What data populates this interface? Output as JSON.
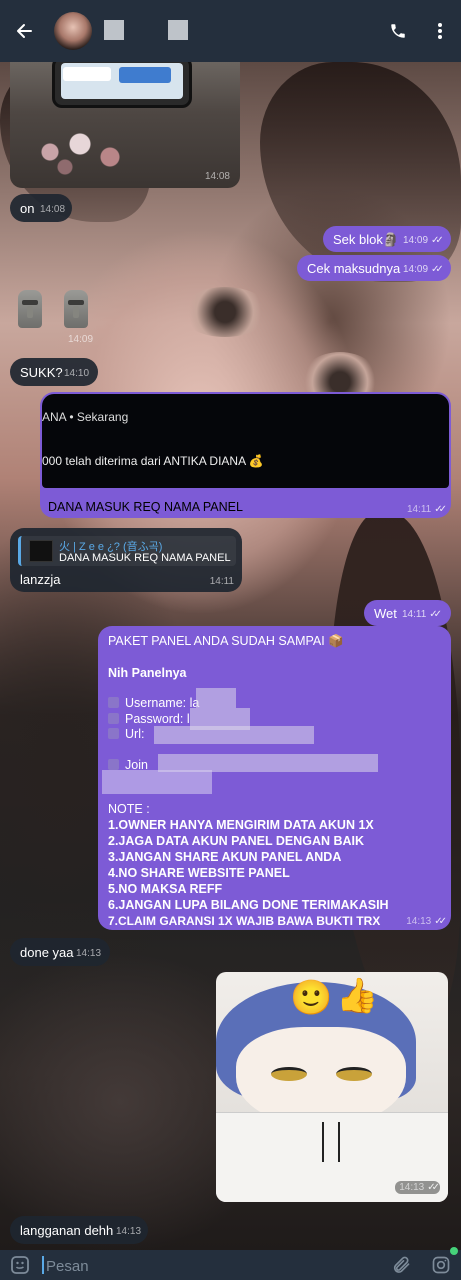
{
  "header": {
    "back_icon": "arrow-left-icon",
    "call_icon": "phone-icon",
    "menu_icon": "more-vertical-icon"
  },
  "messages": [
    {
      "id": "m1",
      "type": "media",
      "time": "14:08"
    },
    {
      "id": "m2",
      "type": "in",
      "text": "on",
      "time": "14:08"
    },
    {
      "id": "m3",
      "type": "out",
      "text": "Sek blok🗿",
      "time": "14:09"
    },
    {
      "id": "m4",
      "type": "out",
      "text": "Cek maksudnya",
      "time": "14:09"
    },
    {
      "id": "m5",
      "type": "in-emoji",
      "text": "🗿🗿",
      "time": "14:09"
    },
    {
      "id": "m6",
      "type": "in",
      "text": "SUKK?",
      "time": "14:10"
    },
    {
      "id": "m7",
      "type": "out-image",
      "notif_app": "ANA  • Sekarang",
      "notif_msg": "000 telah diterima dari ANTIKA DIANA 💰",
      "caption": "DANA MASUK REQ NAMA PANEL",
      "time": "14:11"
    },
    {
      "id": "m8",
      "type": "in-reply",
      "reply_name": "火 | Z e e ¿?  (音ふ곡)",
      "reply_text": "DANA MASUK REQ NAMA PANEL",
      "text": "lanzzja",
      "time": "14:11"
    },
    {
      "id": "m9",
      "type": "out",
      "text": "Wet",
      "time": "14:11"
    },
    {
      "id": "m11",
      "type": "in",
      "text": "done yaa",
      "time": "14:13"
    },
    {
      "id": "m12",
      "type": "out-sticker",
      "time": "14:13"
    },
    {
      "id": "m13",
      "type": "in",
      "text": "langganan dehh",
      "time": "14:13"
    }
  ],
  "panel_message": {
    "line1": "PAKET PANEL ANDA SUDAH SAMPAI 📦",
    "line2": "Nih Panelnya",
    "username_label": "Username: la",
    "password_label": "Password: l",
    "url_label": "Url: ",
    "join_label": "Join",
    "note": "NOTE :",
    "rules": [
      "1.OWNER HANYA MENGIRIM DATA AKUN 1X",
      "2.JAGA DATA AKUN PANEL DENGAN BAIK",
      "3.JANGAN SHARE AKUN PANEL ANDA",
      "4.NO SHARE WEBSITE PANEL",
      "5.NO MAKSA REFF",
      "6.JANGAN LUPA BILANG DONE TERIMAKASIH",
      "7.CLAIM GARANSI 1X WAJIB BAWA BUKTI TRX"
    ],
    "time": "14:13"
  },
  "sticker": {
    "smiley": "🙂",
    "thumb": "👍"
  },
  "input": {
    "placeholder": "Pesan",
    "emoji_icon": "sticker-emoji-icon",
    "attach_icon": "paperclip-icon",
    "camera_icon": "camera-icon"
  },
  "colors": {
    "outgoing": "#7d5bd6",
    "incoming": "#1e2630",
    "topbar": "#242f3d",
    "accent": "#5aa9e6"
  }
}
